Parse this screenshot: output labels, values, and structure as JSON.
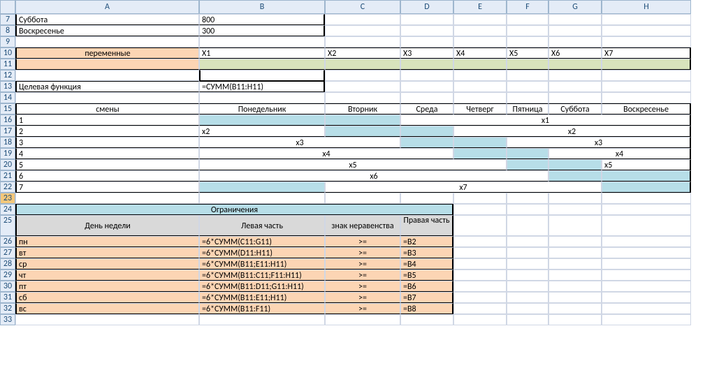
{
  "cols": [
    "A",
    "B",
    "C",
    "D",
    "E",
    "F",
    "G",
    "H"
  ],
  "rows": [
    "7",
    "8",
    "9",
    "10",
    "11",
    "12",
    "13",
    "14",
    "15",
    "16",
    "17",
    "18",
    "19",
    "20",
    "21",
    "22",
    "23",
    "24",
    "25",
    "26",
    "27",
    "28",
    "29",
    "30",
    "31",
    "32",
    "33"
  ],
  "r7": {
    "A": "Суббота",
    "B": "800"
  },
  "r8": {
    "A": "Воскресенье",
    "B": "300"
  },
  "r10": {
    "A": "переменные",
    "B": "X1",
    "C": "X2",
    "D": "X3",
    "E": "X4",
    "F": "X5",
    "G": "X6",
    "H": "X7"
  },
  "r13": {
    "A": "Целевая функция",
    "B": "=СУММ(B11:H11)"
  },
  "r15": {
    "A": "смены",
    "B": "Понедельник",
    "C": "Вторник",
    "D": "Среда",
    "E": "Четверг",
    "F": "Пятница",
    "G": "Суббота",
    "H": "Воскресенье"
  },
  "r16": {
    "A": "1",
    "x": "x1"
  },
  "r17": {
    "A": "2",
    "B": "x2",
    "x": "x2"
  },
  "r18": {
    "A": "3",
    "x1": "x3",
    "x2": "x3"
  },
  "r19": {
    "A": "4",
    "x1": "x4",
    "x2": "x4"
  },
  "r20": {
    "A": "5",
    "x1": "x5",
    "x2": "x5"
  },
  "r21": {
    "A": "6",
    "x": "x6"
  },
  "r22": {
    "A": "7",
    "x": "x7"
  },
  "r24": {
    "title": "Ограничения"
  },
  "r25": {
    "A": "День недели",
    "B": "Левая часть",
    "C": "знак неравенства",
    "D": "Правая часть"
  },
  "r26": {
    "A": "пн",
    "B": "=6*СУММ(C11:G11)",
    "C": ">=",
    "D": "=B2"
  },
  "r27": {
    "A": "вт",
    "B": "=6*СУММ(D11:H11)",
    "C": ">=",
    "D": "=B3"
  },
  "r28": {
    "A": "ср",
    "B": "=6*СУММ(B11;E11:H11)",
    "C": ">=",
    "D": "=B4"
  },
  "r29": {
    "A": "чт",
    "B": "=6*СУММ(B11:C11;F11:H11)",
    "C": ">=",
    "D": "=B5"
  },
  "r30": {
    "A": "пт",
    "B": "=6*СУММ(B11:D11;G11:H11)",
    "C": ">=",
    "D": "=B6"
  },
  "r31": {
    "A": "сб",
    "B": "=6*СУММ(B11:E11;H11)",
    "C": ">=",
    "D": "=B7"
  },
  "r32": {
    "A": "вс",
    "B": "=6*СУММ(B11:F11)",
    "C": ">=",
    "D": "=B8"
  }
}
